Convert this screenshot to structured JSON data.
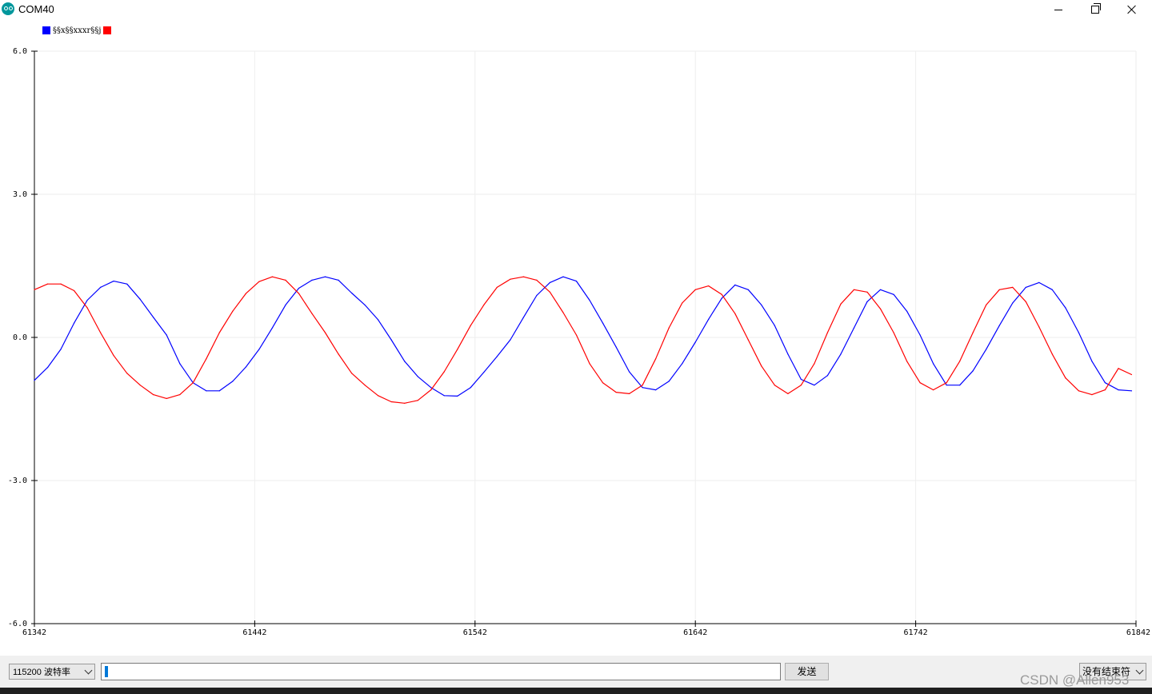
{
  "window": {
    "title": "COM40"
  },
  "legend": {
    "label": "§§x§§xxxr§§j"
  },
  "colors": {
    "series1": "#0000ff",
    "series2": "#ff0000",
    "grid": "#eeeeee",
    "axis": "#000000"
  },
  "chart_data": {
    "type": "line",
    "title": "",
    "xlabel": "",
    "ylabel": "",
    "xlim": [
      61342,
      61842
    ],
    "ylim": [
      -6.0,
      6.0
    ],
    "x_ticks": [
      61342,
      61442,
      61542,
      61642,
      61742,
      61842
    ],
    "x_tick_labels": [
      "61342",
      "61442",
      "61542",
      "61642",
      "61742",
      "61842"
    ],
    "y_ticks": [
      6.0,
      3.0,
      0.0,
      -3.0,
      -6.0
    ],
    "y_tick_labels": [
      "6.0",
      "3.0",
      "0.0",
      "-3.0",
      "-6.0"
    ],
    "grid": true,
    "legend_position": "top-left",
    "series": [
      {
        "color": "#0000ff",
        "x": [
          61342,
          61348,
          61354,
          61360,
          61366,
          61372,
          61378,
          61384,
          61390,
          61396,
          61402,
          61408,
          61414,
          61420,
          61426,
          61432,
          61438,
          61444,
          61450,
          61456,
          61462,
          61468,
          61474,
          61480,
          61486,
          61492,
          61498,
          61504,
          61510,
          61516,
          61522,
          61528,
          61534,
          61540,
          61546,
          61552,
          61558,
          61564,
          61570,
          61576,
          61582,
          61588,
          61594,
          61600,
          61606,
          61612,
          61618,
          61624,
          61630,
          61636,
          61642,
          61648,
          61654,
          61660,
          61666,
          61672,
          61678,
          61684,
          61690,
          61696,
          61702,
          61708,
          61714,
          61720,
          61726,
          61732,
          61738,
          61744,
          61750,
          61756,
          61762,
          61768,
          61774,
          61780,
          61786,
          61792,
          61798,
          61804,
          61810,
          61816,
          61822,
          61828,
          61834,
          61840
        ],
        "y": [
          -0.9,
          -0.63,
          -0.25,
          0.3,
          0.78,
          1.05,
          1.18,
          1.12,
          0.8,
          0.42,
          0.05,
          -0.55,
          -0.95,
          -1.12,
          -1.12,
          -0.92,
          -0.62,
          -0.25,
          0.2,
          0.68,
          1.03,
          1.2,
          1.27,
          1.2,
          0.93,
          0.68,
          0.37,
          -0.05,
          -0.5,
          -0.82,
          -1.05,
          -1.22,
          -1.23,
          -1.05,
          -0.73,
          -0.4,
          -0.05,
          0.42,
          0.88,
          1.15,
          1.27,
          1.18,
          0.78,
          0.3,
          -0.2,
          -0.72,
          -1.05,
          -1.1,
          -0.92,
          -0.55,
          -0.1,
          0.38,
          0.82,
          1.1,
          1.0,
          0.68,
          0.25,
          -0.35,
          -0.88,
          -1.0,
          -0.8,
          -0.35,
          0.2,
          0.75,
          1.0,
          0.9,
          0.55,
          0.05,
          -0.55,
          -1.0,
          -1.0,
          -0.7,
          -0.25,
          0.25,
          0.72,
          1.05,
          1.15,
          1.0,
          0.62,
          0.1,
          -0.5,
          -0.95,
          -1.1,
          -1.12
        ]
      },
      {
        "color": "#ff0000",
        "x": [
          61342,
          61348,
          61354,
          61360,
          61366,
          61372,
          61378,
          61384,
          61390,
          61396,
          61402,
          61408,
          61414,
          61420,
          61426,
          61432,
          61438,
          61444,
          61450,
          61456,
          61462,
          61468,
          61474,
          61480,
          61486,
          61492,
          61498,
          61504,
          61510,
          61516,
          61522,
          61528,
          61534,
          61540,
          61546,
          61552,
          61558,
          61564,
          61570,
          61576,
          61582,
          61588,
          61594,
          61600,
          61606,
          61612,
          61618,
          61624,
          61630,
          61636,
          61642,
          61648,
          61654,
          61660,
          61666,
          61672,
          61678,
          61684,
          61690,
          61696,
          61702,
          61708,
          61714,
          61720,
          61726,
          61732,
          61738,
          61744,
          61750,
          61756,
          61762,
          61768,
          61774,
          61780,
          61786,
          61792,
          61798,
          61804,
          61810,
          61816,
          61822,
          61828,
          61834,
          61840
        ],
        "y": [
          1.0,
          1.12,
          1.12,
          0.98,
          0.62,
          0.1,
          -0.38,
          -0.75,
          -1.0,
          -1.2,
          -1.28,
          -1.2,
          -0.95,
          -0.45,
          0.1,
          0.55,
          0.92,
          1.17,
          1.27,
          1.2,
          0.92,
          0.5,
          0.1,
          -0.35,
          -0.75,
          -1.0,
          -1.22,
          -1.35,
          -1.38,
          -1.32,
          -1.1,
          -0.72,
          -0.25,
          0.25,
          0.68,
          1.05,
          1.22,
          1.27,
          1.2,
          0.95,
          0.52,
          0.05,
          -0.55,
          -0.95,
          -1.15,
          -1.18,
          -1.0,
          -0.45,
          0.2,
          0.72,
          1.0,
          1.08,
          0.9,
          0.5,
          -0.05,
          -0.6,
          -1.0,
          -1.18,
          -1.0,
          -0.55,
          0.1,
          0.7,
          1.0,
          0.95,
          0.6,
          0.1,
          -0.5,
          -0.95,
          -1.1,
          -0.95,
          -0.5,
          0.1,
          0.68,
          1.0,
          1.05,
          0.75,
          0.22,
          -0.35,
          -0.85,
          -1.12,
          -1.2,
          -1.1,
          -0.65,
          -0.78
        ]
      }
    ]
  },
  "bottom": {
    "baud_value": "115200  波特率",
    "send_label": "发送",
    "line_ending_value": "没有结束符"
  },
  "watermark": "CSDN @Allen953"
}
